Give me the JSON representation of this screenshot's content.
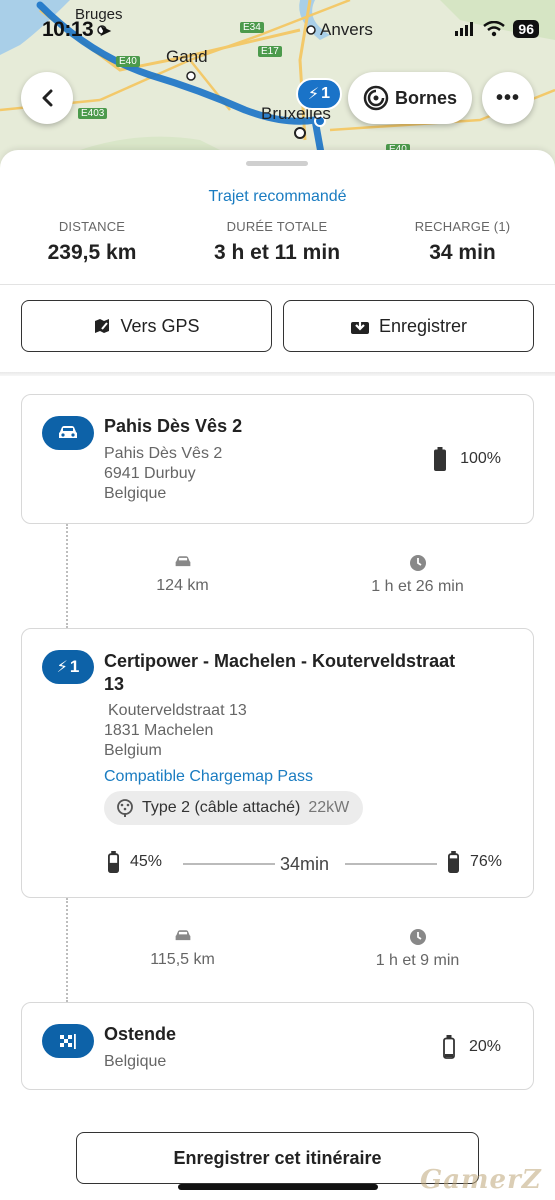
{
  "status_bar": {
    "time": "10:13",
    "battery": "96"
  },
  "map": {
    "cities": [
      "Bruges",
      "Anvers",
      "Gand",
      "Bruxelles"
    ],
    "roads": [
      "E34",
      "E17",
      "E40",
      "E403",
      "E40"
    ],
    "charge_marker": "1",
    "bornes_label": "Bornes"
  },
  "summary": {
    "route_type": "Trajet recommandé",
    "distance_label": "DISTANCE",
    "distance_value": "239,5 km",
    "duration_label": "DURÉE TOTALE",
    "duration_value": "3 h et 11 min",
    "recharge_label": "RECHARGE (1)",
    "recharge_value": "34 min"
  },
  "actions": {
    "gps": "Vers GPS",
    "save": "Enregistrer"
  },
  "start": {
    "title": "Pahis Dès Vês 2",
    "lines": [
      "Pahis Dès Vês 2",
      "6941 Durbuy",
      "Belgique"
    ],
    "battery": "100%"
  },
  "leg1": {
    "distance": "124 km",
    "duration": "1 h et 26 min"
  },
  "stop": {
    "badge": "1",
    "title_l1": "Certipower - Machelen - Kouterveldstraat",
    "title_l2": "13",
    "lines": [
      "Kouterveldstraat 13",
      "1831 Machelen",
      "Belgium"
    ],
    "compat": "Compatible Chargemap Pass",
    "connector": "Type 2 (câble attaché)",
    "power": "22kW",
    "battery_in": "45%",
    "charge_time": "34min",
    "battery_out": "76%"
  },
  "leg2": {
    "distance": "115,5 km",
    "duration": "1 h et 9 min"
  },
  "end": {
    "title": "Ostende",
    "lines": [
      "Belgique"
    ],
    "battery": "20%"
  },
  "cta": "Enregistrer cet itinéraire",
  "watermark": "GamerZ",
  "colors": {
    "accent": "#0d62a8",
    "link": "#1a7cc1",
    "route": "#1a73c8"
  }
}
